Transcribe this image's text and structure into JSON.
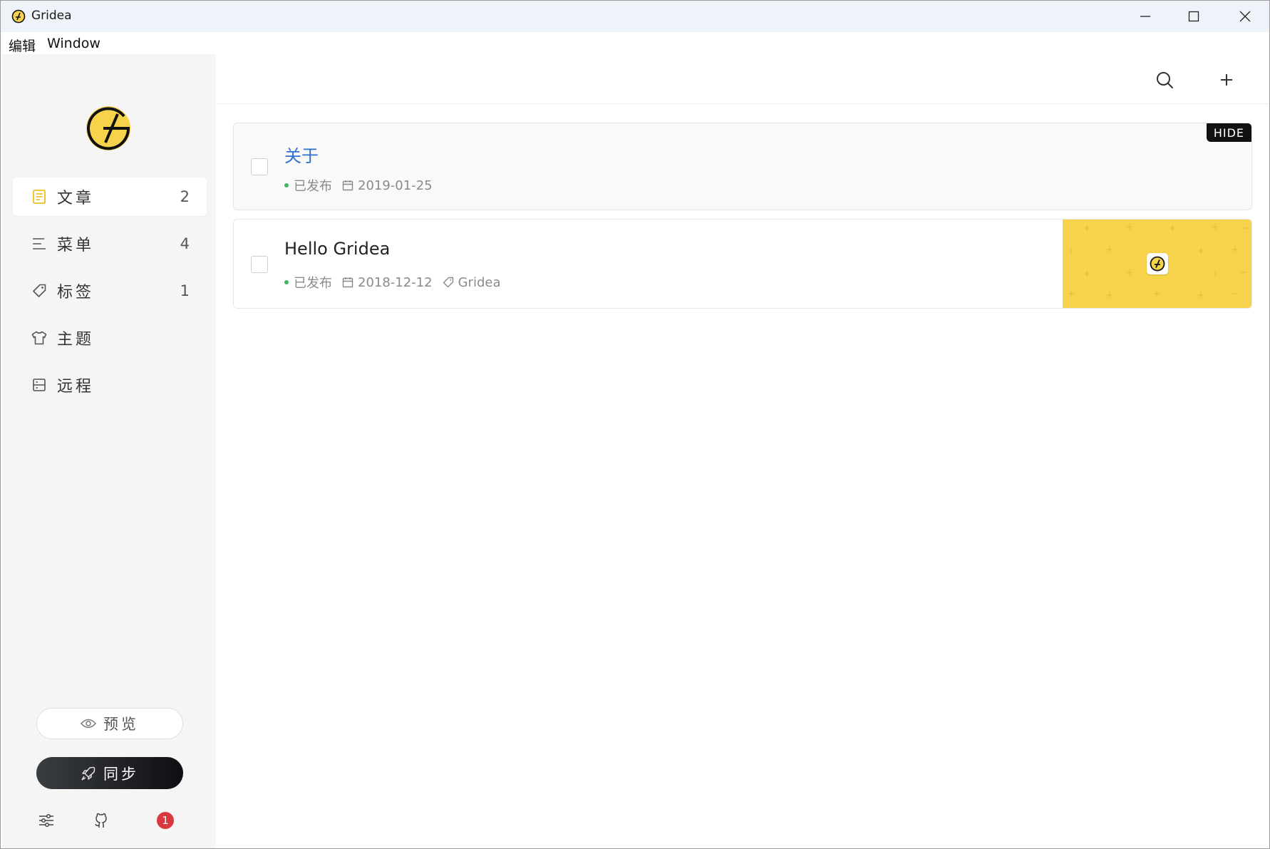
{
  "window": {
    "title": "Gridea"
  },
  "menubar": {
    "items": [
      "编辑",
      "Window"
    ]
  },
  "sidebar": {
    "nav": [
      {
        "label": "文章",
        "count": "2",
        "icon": "article-icon",
        "active": true
      },
      {
        "label": "菜单",
        "count": "4",
        "icon": "menu-icon",
        "active": false
      },
      {
        "label": "标签",
        "count": "1",
        "icon": "tag-icon",
        "active": false
      },
      {
        "label": "主题",
        "count": "",
        "icon": "shirt-icon",
        "active": false
      },
      {
        "label": "远程",
        "count": "",
        "icon": "server-icon",
        "active": false
      }
    ],
    "preview_label": "预览",
    "sync_label": "同步",
    "notification_count": "1"
  },
  "posts": [
    {
      "title": "关于",
      "status": "已发布",
      "date": "2019-01-25",
      "tag": "",
      "hidden_label": "HIDE"
    },
    {
      "title": "Hello Gridea",
      "status": "已发布",
      "date": "2018-12-12",
      "tag": "Gridea",
      "hidden_label": ""
    }
  ],
  "colors": {
    "accent_yellow": "#f6d34b",
    "link_blue": "#2e6fd0",
    "published_green": "#3fb56b",
    "badge_red": "#d9393f"
  }
}
